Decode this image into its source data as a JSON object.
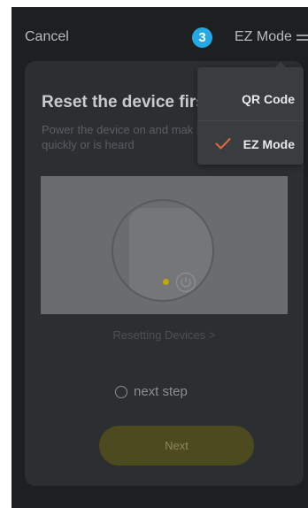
{
  "header": {
    "cancel_label": "Cancel",
    "step_number": "3",
    "mode_label": "EZ Mode",
    "mode_icon": "swap-icon"
  },
  "card": {
    "title": "Reset the device firs",
    "description": "Power the device on and mak indicator is flashing quickly or is heard",
    "illustration": {
      "led_color": "#c2a800",
      "icon": "power-icon"
    },
    "resetting_link": "Resetting Devices >",
    "confirm_label": "next step",
    "next_button": "Next"
  },
  "dropdown": {
    "items": [
      {
        "label": "QR Code",
        "selected": false
      },
      {
        "label": "EZ Mode",
        "selected": true
      }
    ],
    "check_color": "#e8663b"
  },
  "colors": {
    "background": "#1d1f20",
    "card": "#2c2f31",
    "accent_badge": "#25a8e6",
    "next_button_bg": "#4d4a1f"
  }
}
